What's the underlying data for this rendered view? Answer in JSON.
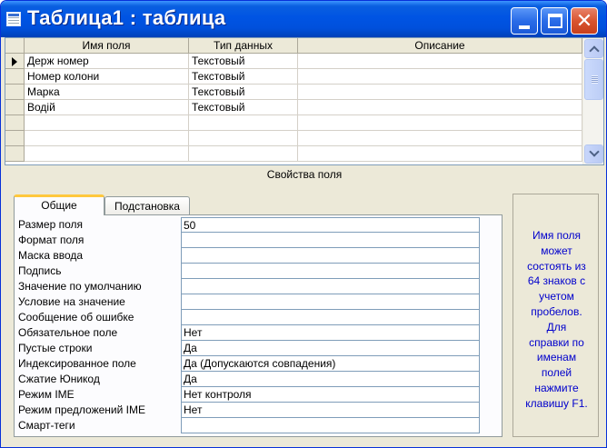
{
  "window": {
    "title": "Таблица1 : таблица"
  },
  "grid": {
    "columns": [
      "Имя поля",
      "Тип данных",
      "Описание"
    ],
    "rows": [
      {
        "name": "Держ номер",
        "type": "Текстовый",
        "desc": ""
      },
      {
        "name": "Номер колони",
        "type": "Текстовый",
        "desc": ""
      },
      {
        "name": "Марка",
        "type": "Текстовый",
        "desc": ""
      },
      {
        "name": "Водій",
        "type": "Текстовый",
        "desc": ""
      }
    ]
  },
  "properties": {
    "section_label": "Свойства поля",
    "tabs": [
      "Общие",
      "Подстановка"
    ],
    "items": [
      {
        "name": "Размер поля",
        "value": "50"
      },
      {
        "name": "Формат поля",
        "value": ""
      },
      {
        "name": "Маска ввода",
        "value": ""
      },
      {
        "name": "Подпись",
        "value": ""
      },
      {
        "name": "Значение по умолчанию",
        "value": ""
      },
      {
        "name": "Условие на значение",
        "value": ""
      },
      {
        "name": "Сообщение об ошибке",
        "value": ""
      },
      {
        "name": "Обязательное поле",
        "value": "Нет"
      },
      {
        "name": "Пустые строки",
        "value": "Да"
      },
      {
        "name": "Индексированное поле",
        "value": "Да (Допускаются совпадения)"
      },
      {
        "name": "Сжатие Юникод",
        "value": "Да"
      },
      {
        "name": "Режим IME",
        "value": "Нет контроля"
      },
      {
        "name": "Режим предложений IME",
        "value": "Нет"
      },
      {
        "name": "Смарт-теги",
        "value": ""
      }
    ],
    "help_lines": [
      "Имя поля",
      "может",
      "состоять из",
      "64 знаков с",
      "учетом",
      "пробелов.",
      "Для",
      "справки по",
      "именам",
      "полей",
      "нажмите",
      "клавишу F1."
    ]
  }
}
